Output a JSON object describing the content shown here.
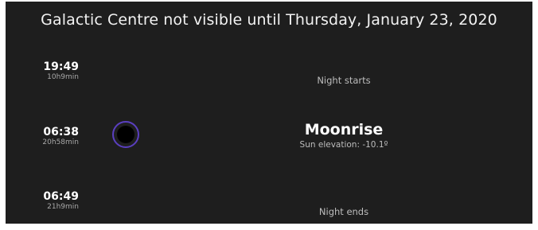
{
  "header": {
    "title": "Galactic Centre not visible until Thursday, January 23, 2020"
  },
  "events": [
    {
      "time": "19:49",
      "duration": "10h9min",
      "label": "Night starts",
      "detail": ""
    },
    {
      "time": "06:38",
      "duration": "20h58min",
      "label": "Moonrise",
      "detail": "Sun elevation: -10.1º",
      "icon": "moon-icon"
    },
    {
      "time": "06:49",
      "duration": "21h9min",
      "label": "Night ends",
      "detail": ""
    }
  ],
  "colors": {
    "background": "#1e1e1e",
    "moon_ring": "#5a3fc0",
    "moon_fill": "#000000",
    "secondary_text": "#bdbdbd"
  }
}
